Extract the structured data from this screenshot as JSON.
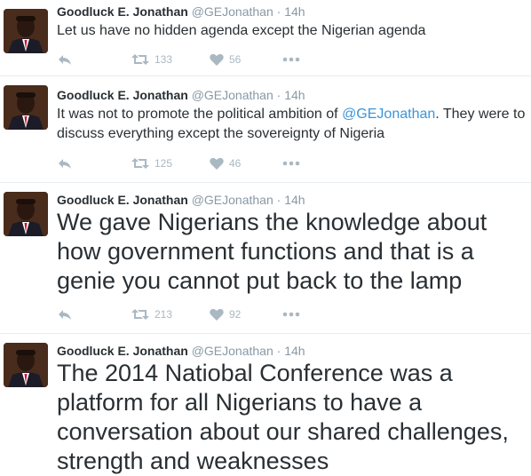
{
  "tweets": [
    {
      "name": "Goodluck E. Jonathan",
      "handle": "@GEJonathan",
      "dot": "·",
      "time": "14h",
      "text_before": "Let us  have no hidden agenda except the Nigerian agenda",
      "mention": "",
      "text_after": "",
      "retweets": "133",
      "likes": "56"
    },
    {
      "name": "Goodluck E. Jonathan",
      "handle": "@GEJonathan",
      "dot": "·",
      "time": "14h",
      "text_before": "It was not to promote the political ambition of ",
      "mention": "@GEJonathan",
      "text_after": ". They were to discuss everything except the sovereignty of Nigeria",
      "retweets": "125",
      "likes": "46"
    },
    {
      "name": "Goodluck E. Jonathan",
      "handle": "@GEJonathan",
      "dot": "·",
      "time": "14h",
      "text_before": "We gave Nigerians the knowledge about how government functions and that is a genie you cannot put back to the lamp",
      "mention": "",
      "text_after": "",
      "retweets": "213",
      "likes": "92"
    },
    {
      "name": "Goodluck E. Jonathan",
      "handle": "@GEJonathan",
      "dot": "·",
      "time": "14h",
      "text_before": "The 2014 Natiobal Conference was a platform for all Nigerians to have a conversation about our shared challenges, strength and weaknesses",
      "mention": "",
      "text_after": "",
      "retweets": "",
      "likes": ""
    }
  ],
  "icons": {
    "reply": "reply-icon",
    "retweet": "retweet-icon",
    "like": "heart-icon",
    "more": "more-icon"
  },
  "colors": {
    "name": "#292f33",
    "meta": "#8899a6",
    "mention": "#3b94d9",
    "action": "#aab8c2",
    "divider": "#e6ecf0"
  }
}
